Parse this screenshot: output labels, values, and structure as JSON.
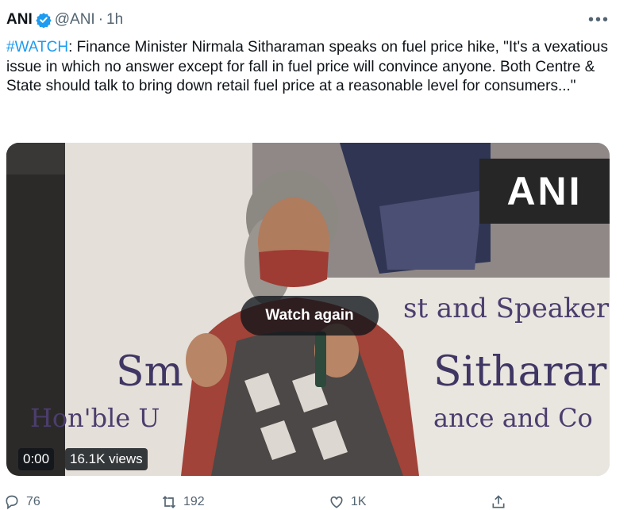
{
  "tweet": {
    "author_name": "ANI",
    "handle": "@ANI",
    "separator": "·",
    "time": "1h",
    "more_label": "•••",
    "hashtag": "#WATCH",
    "text": ": Finance Minister Nirmala Sitharaman speaks on fuel price hike, \"It's a vexatious issue in which no answer except for fall in fuel price will convince anyone. Both Centre & State should talk to bring down retail fuel price at a reasonable level for consumers...\""
  },
  "media": {
    "logo": "ANI",
    "banner_line1": "st and Speaker",
    "banner_line2a": "Sm",
    "banner_line2b": "Sitharar",
    "banner_line3a": "Hon'ble U",
    "banner_line3b": "ance and Co",
    "overlay": "Watch again",
    "time": "0:00",
    "views": "16.1K views"
  },
  "actions": {
    "replies": "76",
    "retweets": "192",
    "likes": "1K"
  },
  "colors": {
    "accent": "#1d9bf0",
    "text": "#0f1419",
    "secondary": "#536471"
  }
}
